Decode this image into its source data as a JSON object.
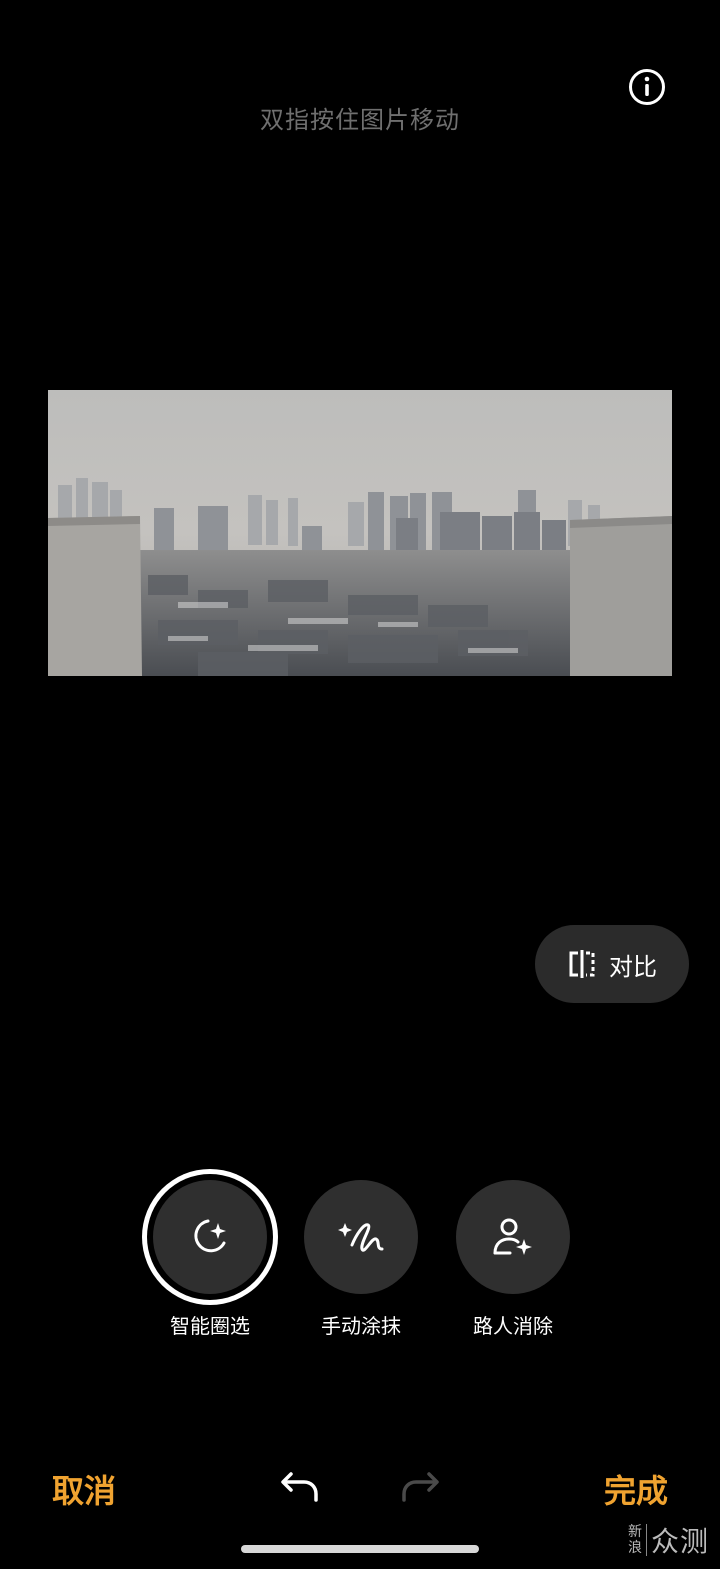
{
  "hint": "双指按住图片移动",
  "compare": {
    "label": "对比"
  },
  "tools": [
    {
      "label": "智能圈选",
      "active": true
    },
    {
      "label": "手动涂抹",
      "active": false
    },
    {
      "label": "路人消除",
      "active": false
    }
  ],
  "bottom": {
    "cancel": "取消",
    "done": "完成"
  },
  "watermark": {
    "small_top": "新",
    "small_bottom": "浪",
    "big": "众测"
  },
  "colors": {
    "accent": "#f0a330",
    "background": "#000000",
    "button": "#2f2f2f"
  },
  "icons": {
    "info": "info-icon",
    "compare": "compare-split-icon",
    "smart_select": "lasso-sparkle-icon",
    "manual": "brush-sparkle-icon",
    "passerby": "person-sparkle-icon",
    "undo": "undo-icon",
    "redo": "redo-icon"
  }
}
